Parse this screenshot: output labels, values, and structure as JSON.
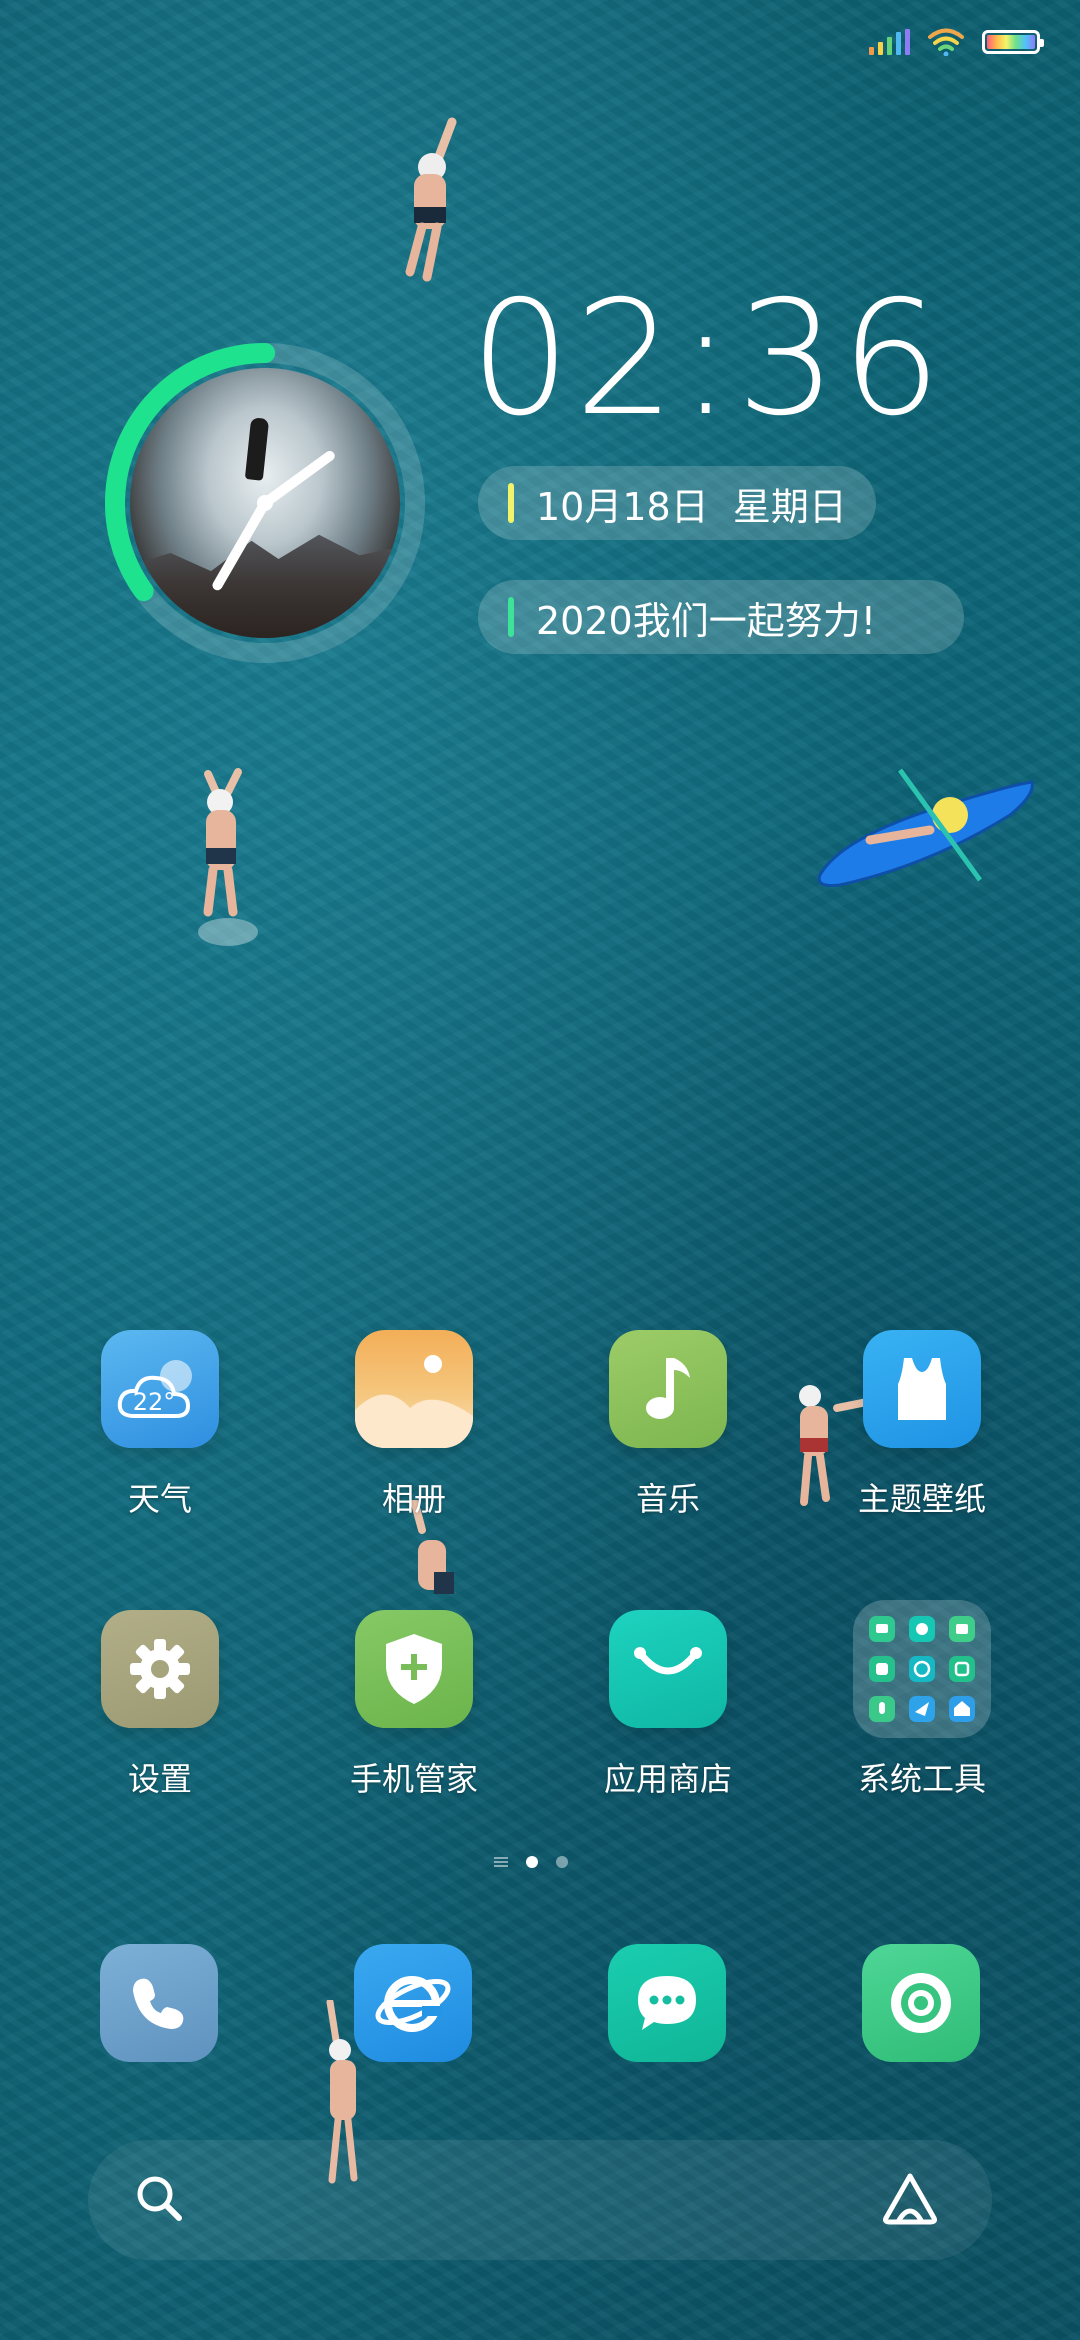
{
  "status_bar": {
    "battery_level": 1.0
  },
  "clock": {
    "time": "02:36",
    "ring_progress": 0.35,
    "ring_color": "#1fe28e"
  },
  "date_pill": {
    "text": "10月18日  星期日",
    "accent": "#f1f36b"
  },
  "motto_pill": {
    "text": "2020我们一起努力!",
    "accent": "#3ee39a"
  },
  "apps": [
    {
      "label": "天气",
      "icon": "weather-icon",
      "icon_text": "22°",
      "color": "#3aa3e8"
    },
    {
      "label": "相册",
      "icon": "gallery-icon",
      "color": "#f5b868"
    },
    {
      "label": "音乐",
      "icon": "music-icon",
      "color": "#8cc460"
    },
    {
      "label": "主题壁纸",
      "icon": "theme-icon",
      "color": "#2aa4ec"
    },
    {
      "label": "设置",
      "icon": "gear-icon",
      "color": "#a7a57f"
    },
    {
      "label": "手机管家",
      "icon": "security-shield-icon",
      "color": "#7bc25a"
    },
    {
      "label": "应用商店",
      "icon": "app-store-bag-icon",
      "color": "#16c7b4"
    },
    {
      "label": "系统工具",
      "icon": "folder-icon",
      "color": "rgba(255,255,255,0.18)"
    }
  ],
  "page_indicator": {
    "pages": 2,
    "current": 1
  },
  "dock": [
    {
      "icon": "phone-icon",
      "color": "#6fa3cb"
    },
    {
      "icon": "browser-icon",
      "color": "#2e9ee9"
    },
    {
      "icon": "messages-icon",
      "color": "#13c3a4"
    },
    {
      "icon": "camera-icon",
      "color": "#3fce8a"
    }
  ],
  "search_bar": {
    "left_icon": "search-icon",
    "right_icon": "assistant-icon"
  }
}
